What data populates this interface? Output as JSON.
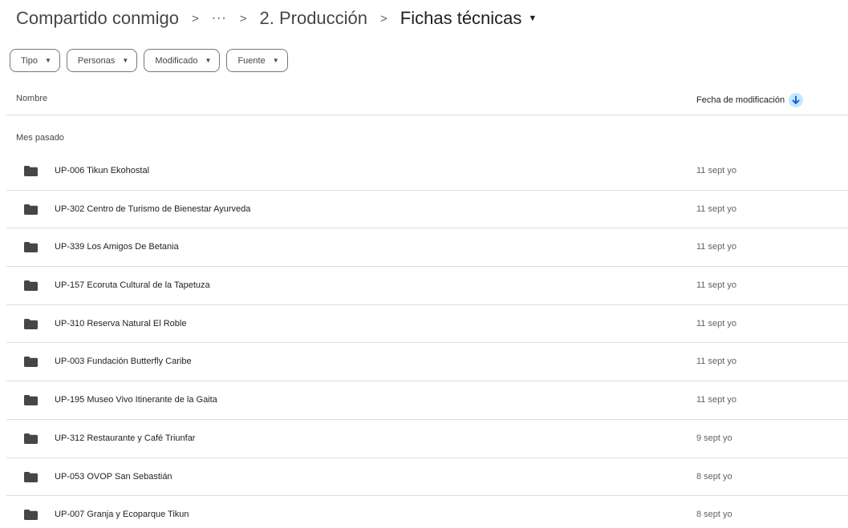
{
  "breadcrumb": {
    "root": "Compartido conmigo",
    "ellipsis": "···",
    "parent": "2. Producción",
    "current": "Fichas técnicas"
  },
  "filters": [
    {
      "label": "Tipo"
    },
    {
      "label": "Personas"
    },
    {
      "label": "Modificado"
    },
    {
      "label": "Fuente"
    }
  ],
  "table": {
    "col_name": "Nombre",
    "col_date": "Fecha de modificación",
    "group": "Mes pasado",
    "rows": [
      {
        "name": "UP-006 Tikun Ekohostal",
        "date": "11 sept yo"
      },
      {
        "name": "UP-302 Centro de Turismo de Bienestar Ayurveda",
        "date": "11 sept yo"
      },
      {
        "name": "UP-339 Los Amigos De Betania",
        "date": "11 sept yo"
      },
      {
        "name": "UP-157 Ecoruta Cultural de la Tapetuza",
        "date": "11 sept yo"
      },
      {
        "name": "UP-310 Reserva Natural El Roble",
        "date": "11 sept yo"
      },
      {
        "name": "UP-003 Fundación Butterfly Caribe",
        "date": "11 sept yo"
      },
      {
        "name": "UP-195 Museo Vivo Itinerante de la Gaita",
        "date": "11 sept yo"
      },
      {
        "name": "UP-312 Restaurante y Café Triunfar",
        "date": "9 sept yo"
      },
      {
        "name": "UP-053 OVOP San Sebastián",
        "date": "8 sept yo"
      },
      {
        "name": "UP-007 Granja y Ecoparque Tikun",
        "date": "8 sept yo"
      }
    ]
  },
  "colors": {
    "folder": "#444746",
    "sort_accent": "#0b57d0",
    "sort_bg": "#c2e7ff"
  }
}
